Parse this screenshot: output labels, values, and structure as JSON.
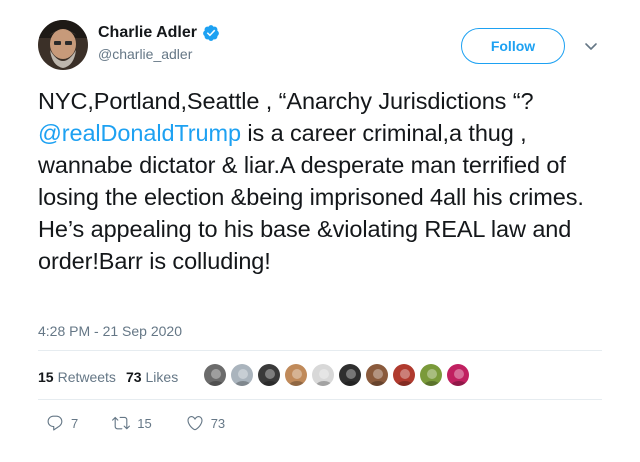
{
  "author": {
    "display_name": "Charlie Adler",
    "handle": "@charlie_adler",
    "verified": true,
    "verified_color": "#1da1f2"
  },
  "follow": {
    "label": "Follow"
  },
  "tweet": {
    "text_before": "NYC,Portland,Seattle , “Anarchy Jurisdictions “? ",
    "mention": "@realDonaldTrump",
    "text_after": " is a career criminal,a thug , wannabe dictator & liar.A desperate man terrified of losing the election &being imprisoned 4all his crimes. He’s appealing to his base &violating REAL law and order!Barr is colluding!",
    "timestamp": "4:28 PM - 21 Sep 2020"
  },
  "stats": {
    "retweets_count": "15",
    "retweets_label": "Retweets",
    "likes_count": "73",
    "likes_label": "Likes"
  },
  "liker_avatars": [
    {
      "color": "#6b6b6b"
    },
    {
      "color": "#aab4bd"
    },
    {
      "color": "#3a3a3a"
    },
    {
      "color": "#c08a5a"
    },
    {
      "color": "#d8d8d8"
    },
    {
      "color": "#2f2f2f"
    },
    {
      "color": "#8a5a3c"
    },
    {
      "color": "#b03a2e"
    },
    {
      "color": "#7a9a3a"
    },
    {
      "color": "#c02060"
    }
  ],
  "actions": {
    "reply_count": "7",
    "retweet_count": "15",
    "like_count": "73"
  },
  "colors": {
    "accent": "#1da1f2",
    "text": "#14171a",
    "secondary": "#657786",
    "divider": "#e6ecf0"
  }
}
